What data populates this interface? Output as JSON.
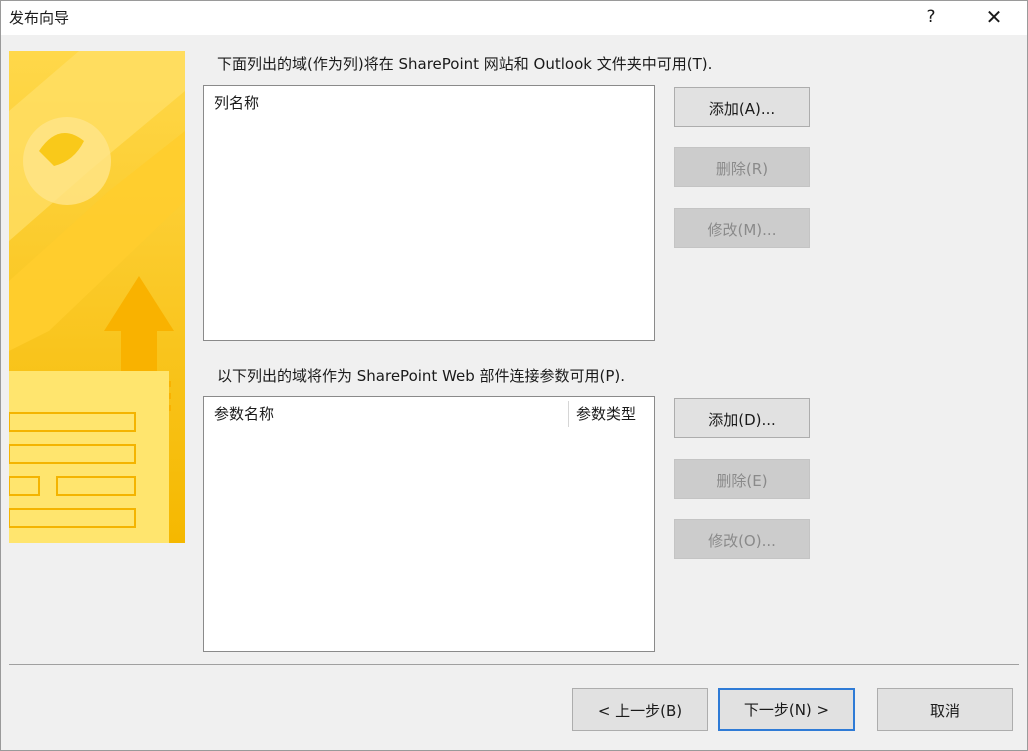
{
  "window": {
    "title": "发布向导",
    "help_label": "?",
    "close_label": "✕"
  },
  "section1": {
    "label": "下面列出的域(作为列)将在 SharePoint 网站和 Outlook 文件夹中可用(T).",
    "column_header": "列名称",
    "add_label": "添加(A)...",
    "delete_label": "删除(R)",
    "modify_label": "修改(M)..."
  },
  "section2": {
    "label": "以下列出的域将作为 SharePoint Web 部件连接参数可用(P).",
    "col_name_header": "参数名称",
    "col_type_header": "参数类型",
    "add_label": "添加(D)...",
    "delete_label": "删除(E)",
    "modify_label": "修改(O)..."
  },
  "footer": {
    "back_label": "< 上一步(B)",
    "next_label": "下一步(N) >",
    "cancel_label": "取消"
  },
  "colors": {
    "banner_light": "#ffd84a",
    "banner_dark": "#f5b800",
    "default_button_border": "#2f7bd6"
  },
  "icons": {
    "help": "question-icon",
    "close": "close-icon",
    "banner": "wizard-banner-graphic"
  }
}
